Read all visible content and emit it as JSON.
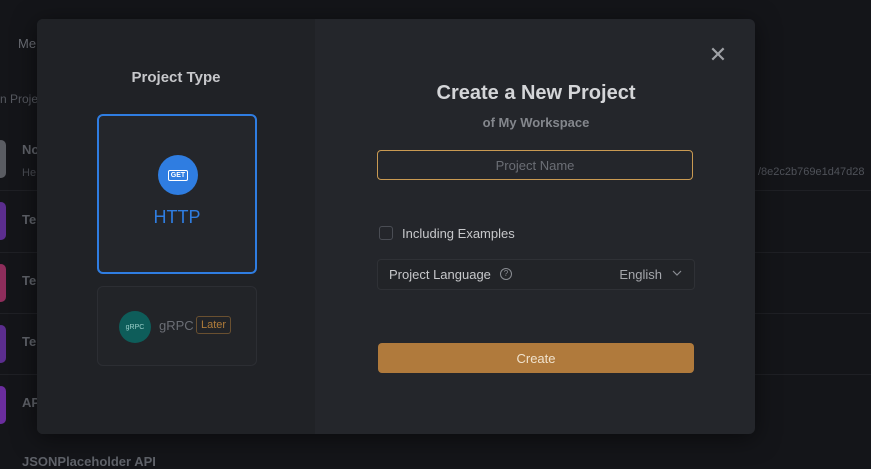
{
  "background": {
    "tab_label": "Me",
    "search_text": "n Proje",
    "rows": [
      {
        "title": "No",
        "sub": "He",
        "icon_color": "#5a5c62"
      },
      {
        "title": "Te",
        "sub": "",
        "icon_color": "#5b2d8e"
      },
      {
        "title": "Te",
        "sub": "",
        "icon_color": "#8e2d5b"
      },
      {
        "title": "Te",
        "sub": "",
        "icon_color": "#5b2d8e"
      },
      {
        "title": "AP",
        "sub": "",
        "icon_color": "#6b2d9e"
      }
    ],
    "hash_text": "/8e2c2b769e1d47d28",
    "bottom_title": "JSONPlaceholder API"
  },
  "modal": {
    "project_type_heading": "Project Type",
    "http_card": {
      "badge": "GET",
      "label": "HTTP",
      "selected": true
    },
    "grpc_card": {
      "icon_text": "gRPC",
      "label": "gRPC",
      "badge": "Later"
    },
    "title": "Create a New Project",
    "subtitle": "of My Workspace",
    "name_input": {
      "value": "",
      "placeholder": "Project Name"
    },
    "including_examples": {
      "label": "Including Examples",
      "checked": false
    },
    "project_language": {
      "label": "Project Language",
      "value": "English"
    },
    "create_label": "Create"
  },
  "colors": {
    "accent_blue": "#2f7de1",
    "create_button": "#b07a3c",
    "input_border_focus": "#c99a52"
  },
  "icons": [
    "close-icon",
    "get-method-icon",
    "grpc-icon",
    "help-icon",
    "chevron-down-icon"
  ]
}
